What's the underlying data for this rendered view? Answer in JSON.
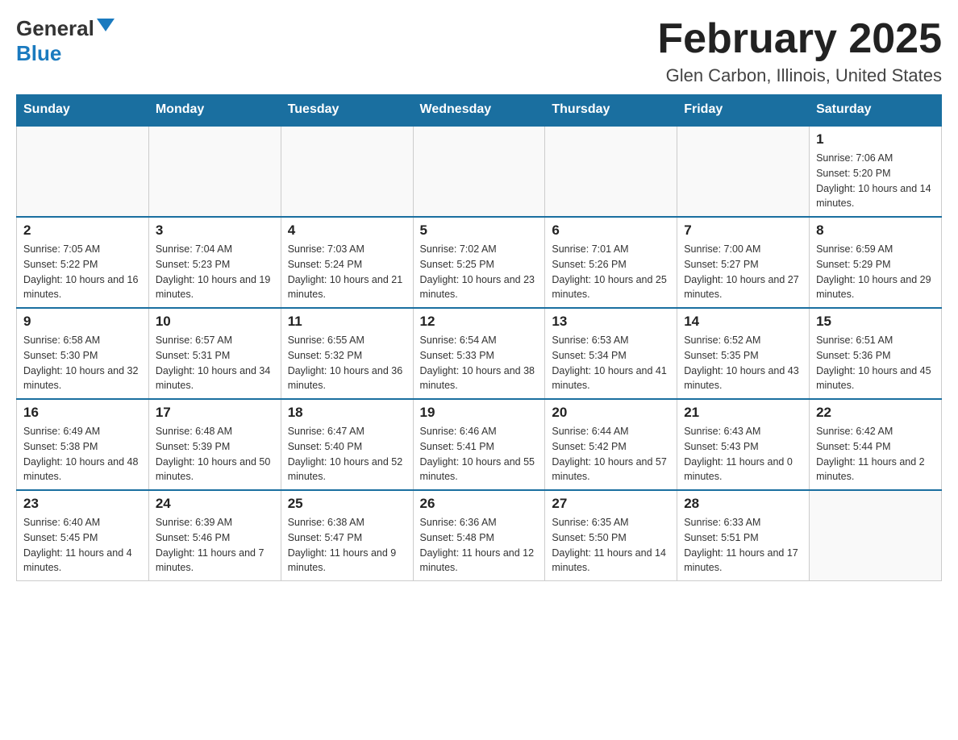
{
  "logo": {
    "line1": "General",
    "line2": "Blue"
  },
  "title": {
    "month": "February 2025",
    "location": "Glen Carbon, Illinois, United States"
  },
  "days_of_week": [
    "Sunday",
    "Monday",
    "Tuesday",
    "Wednesday",
    "Thursday",
    "Friday",
    "Saturday"
  ],
  "weeks": [
    [
      {
        "day": "",
        "info": ""
      },
      {
        "day": "",
        "info": ""
      },
      {
        "day": "",
        "info": ""
      },
      {
        "day": "",
        "info": ""
      },
      {
        "day": "",
        "info": ""
      },
      {
        "day": "",
        "info": ""
      },
      {
        "day": "1",
        "info": "Sunrise: 7:06 AM\nSunset: 5:20 PM\nDaylight: 10 hours and 14 minutes."
      }
    ],
    [
      {
        "day": "2",
        "info": "Sunrise: 7:05 AM\nSunset: 5:22 PM\nDaylight: 10 hours and 16 minutes."
      },
      {
        "day": "3",
        "info": "Sunrise: 7:04 AM\nSunset: 5:23 PM\nDaylight: 10 hours and 19 minutes."
      },
      {
        "day": "4",
        "info": "Sunrise: 7:03 AM\nSunset: 5:24 PM\nDaylight: 10 hours and 21 minutes."
      },
      {
        "day": "5",
        "info": "Sunrise: 7:02 AM\nSunset: 5:25 PM\nDaylight: 10 hours and 23 minutes."
      },
      {
        "day": "6",
        "info": "Sunrise: 7:01 AM\nSunset: 5:26 PM\nDaylight: 10 hours and 25 minutes."
      },
      {
        "day": "7",
        "info": "Sunrise: 7:00 AM\nSunset: 5:27 PM\nDaylight: 10 hours and 27 minutes."
      },
      {
        "day": "8",
        "info": "Sunrise: 6:59 AM\nSunset: 5:29 PM\nDaylight: 10 hours and 29 minutes."
      }
    ],
    [
      {
        "day": "9",
        "info": "Sunrise: 6:58 AM\nSunset: 5:30 PM\nDaylight: 10 hours and 32 minutes."
      },
      {
        "day": "10",
        "info": "Sunrise: 6:57 AM\nSunset: 5:31 PM\nDaylight: 10 hours and 34 minutes."
      },
      {
        "day": "11",
        "info": "Sunrise: 6:55 AM\nSunset: 5:32 PM\nDaylight: 10 hours and 36 minutes."
      },
      {
        "day": "12",
        "info": "Sunrise: 6:54 AM\nSunset: 5:33 PM\nDaylight: 10 hours and 38 minutes."
      },
      {
        "day": "13",
        "info": "Sunrise: 6:53 AM\nSunset: 5:34 PM\nDaylight: 10 hours and 41 minutes."
      },
      {
        "day": "14",
        "info": "Sunrise: 6:52 AM\nSunset: 5:35 PM\nDaylight: 10 hours and 43 minutes."
      },
      {
        "day": "15",
        "info": "Sunrise: 6:51 AM\nSunset: 5:36 PM\nDaylight: 10 hours and 45 minutes."
      }
    ],
    [
      {
        "day": "16",
        "info": "Sunrise: 6:49 AM\nSunset: 5:38 PM\nDaylight: 10 hours and 48 minutes."
      },
      {
        "day": "17",
        "info": "Sunrise: 6:48 AM\nSunset: 5:39 PM\nDaylight: 10 hours and 50 minutes."
      },
      {
        "day": "18",
        "info": "Sunrise: 6:47 AM\nSunset: 5:40 PM\nDaylight: 10 hours and 52 minutes."
      },
      {
        "day": "19",
        "info": "Sunrise: 6:46 AM\nSunset: 5:41 PM\nDaylight: 10 hours and 55 minutes."
      },
      {
        "day": "20",
        "info": "Sunrise: 6:44 AM\nSunset: 5:42 PM\nDaylight: 10 hours and 57 minutes."
      },
      {
        "day": "21",
        "info": "Sunrise: 6:43 AM\nSunset: 5:43 PM\nDaylight: 11 hours and 0 minutes."
      },
      {
        "day": "22",
        "info": "Sunrise: 6:42 AM\nSunset: 5:44 PM\nDaylight: 11 hours and 2 minutes."
      }
    ],
    [
      {
        "day": "23",
        "info": "Sunrise: 6:40 AM\nSunset: 5:45 PM\nDaylight: 11 hours and 4 minutes."
      },
      {
        "day": "24",
        "info": "Sunrise: 6:39 AM\nSunset: 5:46 PM\nDaylight: 11 hours and 7 minutes."
      },
      {
        "day": "25",
        "info": "Sunrise: 6:38 AM\nSunset: 5:47 PM\nDaylight: 11 hours and 9 minutes."
      },
      {
        "day": "26",
        "info": "Sunrise: 6:36 AM\nSunset: 5:48 PM\nDaylight: 11 hours and 12 minutes."
      },
      {
        "day": "27",
        "info": "Sunrise: 6:35 AM\nSunset: 5:50 PM\nDaylight: 11 hours and 14 minutes."
      },
      {
        "day": "28",
        "info": "Sunrise: 6:33 AM\nSunset: 5:51 PM\nDaylight: 11 hours and 17 minutes."
      },
      {
        "day": "",
        "info": ""
      }
    ]
  ]
}
